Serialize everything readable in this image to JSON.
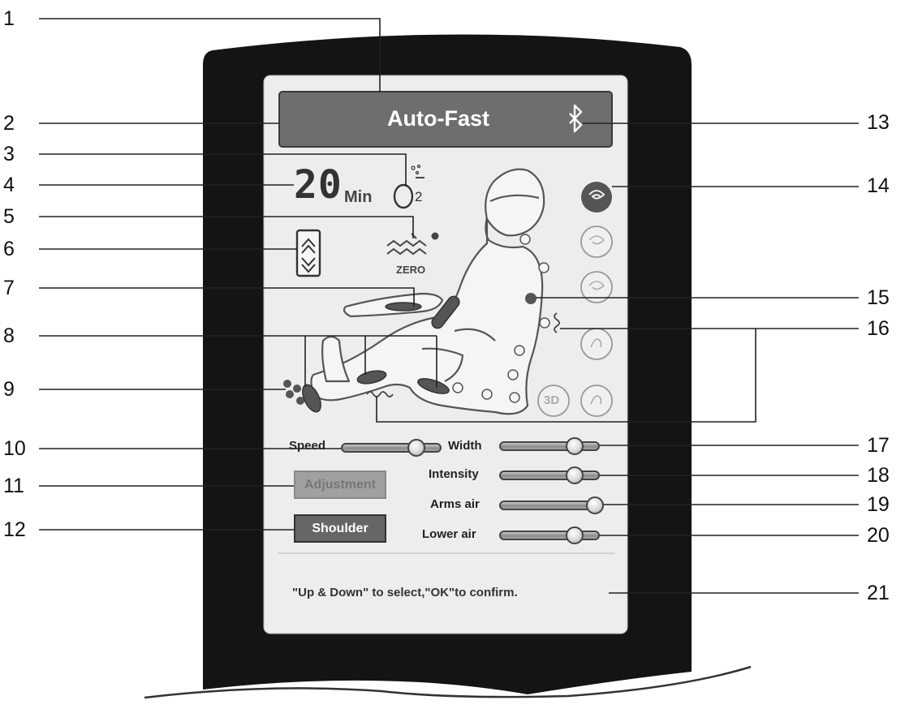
{
  "display": {
    "mode_title": "Auto-Fast",
    "timer_value": "20",
    "timer_unit": "Min",
    "oxygen_label": "O",
    "oxygen_subscript": "2",
    "zero_gravity_label": "ZERO"
  },
  "sliders": [
    {
      "label": "Speed",
      "level": 0.75
    },
    {
      "label": "Width",
      "level": 0.75
    },
    {
      "label": "Intensity",
      "level": 0.75
    },
    {
      "label": "Arms air",
      "level": 0.95
    },
    {
      "label": "Lower air",
      "level": 0.75
    }
  ],
  "buttons": {
    "adjustment": "Adjustment",
    "shoulder": "Shoulder"
  },
  "hint_text": "\"Up & Down\" to select,\"OK\"to confirm.",
  "side_icons": {
    "icon_3d": "3D"
  },
  "callouts_left": [
    "1",
    "2",
    "3",
    "4",
    "5",
    "6",
    "7",
    "8",
    "9",
    "10",
    "11",
    "12"
  ],
  "callouts_right": [
    "13",
    "14",
    "15",
    "16",
    "17",
    "18",
    "19",
    "20",
    "21"
  ],
  "colors": {
    "bezel": "#141414",
    "screen": "#ededed",
    "title_bar": "#6e6e6e",
    "title_text": "#ffffff",
    "leader_line": "#222222"
  }
}
